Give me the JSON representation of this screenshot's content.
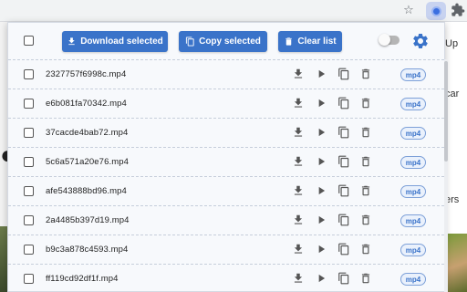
{
  "browser": {
    "star_icon": "star-icon",
    "extension_icon": "video-downloader-extension-icon",
    "extensions_icon": "puzzle-icon"
  },
  "background_page": {
    "right_snippets": [
      "Up",
      "car",
      "ers"
    ]
  },
  "toolbar": {
    "download_selected_label": "Download selected",
    "copy_selected_label": "Copy selected",
    "clear_list_label": "Clear list",
    "toggle_on": false,
    "accent_color": "#3a73c9"
  },
  "files": [
    {
      "name": "2327757f6998c.mp4",
      "type": "mp4"
    },
    {
      "name": "e6b081fa70342.mp4",
      "type": "mp4"
    },
    {
      "name": "37cacde4bab72.mp4",
      "type": "mp4"
    },
    {
      "name": "5c6a571a20e76.mp4",
      "type": "mp4"
    },
    {
      "name": "afe543888bd96.mp4",
      "type": "mp4"
    },
    {
      "name": "2a4485b397d19.mp4",
      "type": "mp4"
    },
    {
      "name": "b9c3a878c4593.mp4",
      "type": "mp4"
    },
    {
      "name": "ff119cd92df1f.mp4",
      "type": "mp4"
    }
  ]
}
